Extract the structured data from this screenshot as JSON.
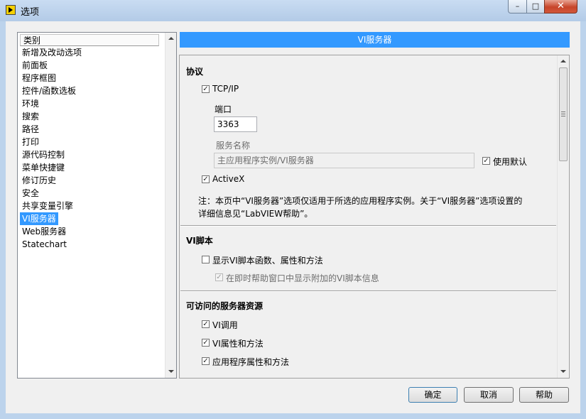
{
  "window": {
    "title": "选项",
    "minimize_glyph": "–",
    "maximize_glyph": "□",
    "close_glyph": "✕"
  },
  "categories": {
    "header": "类别",
    "items": [
      "新增及改动选项",
      "前面板",
      "程序框图",
      "控件/函数选板",
      "环境",
      "搜索",
      "路径",
      "打印",
      "源代码控制",
      "菜单快捷键",
      "修订历史",
      "安全",
      "共享变量引擎",
      "VI服务器",
      "Web服务器",
      "Statechart"
    ],
    "selected": "VI服务器"
  },
  "section_title": "VI服务器",
  "protocol": {
    "heading": "协议",
    "tcp_label": "TCP/IP",
    "tcp_checked": true,
    "port_label": "端口",
    "port_value": "3363",
    "service_label": "服务名称",
    "service_value": "主应用程序实例/VI服务器",
    "use_default_label": "使用默认",
    "use_default_checked": true,
    "activex_label": "ActiveX",
    "activex_checked": true,
    "note_line1": "注：本页中“VI服务器”选项仅适用于所选的应用程序实例。关于“VI服务器”选项设置的",
    "note_line2": "详细信息见“LabVIEW帮助”。"
  },
  "scripting": {
    "heading": "VI脚本",
    "show_label": "显示VI脚本函数、属性和方法",
    "show_checked": false,
    "context_help_label": "在即时帮助窗口中显示附加的VI脚本信息",
    "context_help_checked": true
  },
  "accessible": {
    "heading": "可访问的服务器资源",
    "items": [
      {
        "label": "VI调用",
        "checked": true
      },
      {
        "label": "VI属性和方法",
        "checked": true
      },
      {
        "label": "应用程序属性和方法",
        "checked": true
      }
    ]
  },
  "buttons": {
    "ok": "确定",
    "cancel": "取消",
    "help": "帮助"
  },
  "check_glyph": "✓"
}
